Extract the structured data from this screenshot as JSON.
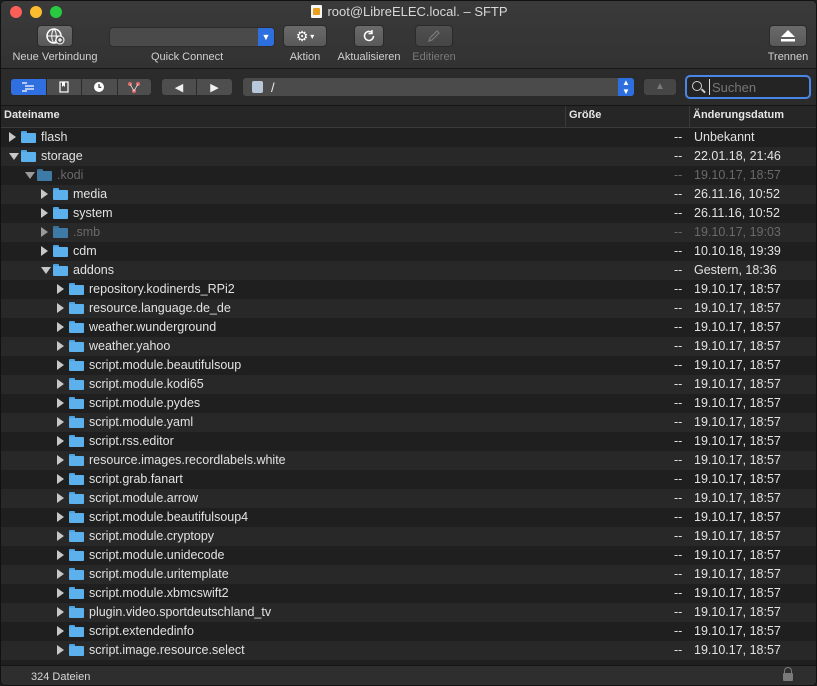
{
  "window": {
    "title": "root@LibreELEC.local. – SFTP"
  },
  "toolbar": {
    "new_connection": "Neue Verbindung",
    "quick_connect": "Quick Connect",
    "quick_connect_value": "",
    "action": "Aktion",
    "refresh": "Aktualisieren",
    "edit": "Editieren",
    "disconnect": "Trennen"
  },
  "pathbar": {
    "path": "/",
    "search_placeholder": "Suchen"
  },
  "columns": {
    "name": "Dateiname",
    "size": "Größe",
    "date": "Änderungsdatum"
  },
  "rows": [
    {
      "name": "flash",
      "size": "--",
      "date": "Unbekannt",
      "depth": 0,
      "expanded": false,
      "dim": false
    },
    {
      "name": "storage",
      "size": "--",
      "date": "22.01.18, 21:46",
      "depth": 0,
      "expanded": true,
      "dim": false
    },
    {
      "name": ".kodi",
      "size": "--",
      "date": "19.10.17, 18:57",
      "depth": 1,
      "expanded": true,
      "dim": true
    },
    {
      "name": "media",
      "size": "--",
      "date": "26.11.16, 10:52",
      "depth": 2,
      "expanded": false,
      "dim": false
    },
    {
      "name": "system",
      "size": "--",
      "date": "26.11.16, 10:52",
      "depth": 2,
      "expanded": false,
      "dim": false
    },
    {
      "name": ".smb",
      "size": "--",
      "date": "19.10.17, 19:03",
      "depth": 2,
      "expanded": false,
      "dim": true
    },
    {
      "name": "cdm",
      "size": "--",
      "date": "10.10.18, 19:39",
      "depth": 2,
      "expanded": false,
      "dim": false
    },
    {
      "name": "addons",
      "size": "--",
      "date": "Gestern, 18:36",
      "depth": 2,
      "expanded": true,
      "dim": false
    },
    {
      "name": "repository.kodinerds_RPi2",
      "size": "--",
      "date": "19.10.17, 18:57",
      "depth": 3,
      "expanded": false,
      "dim": false
    },
    {
      "name": "resource.language.de_de",
      "size": "--",
      "date": "19.10.17, 18:57",
      "depth": 3,
      "expanded": false,
      "dim": false
    },
    {
      "name": "weather.wunderground",
      "size": "--",
      "date": "19.10.17, 18:57",
      "depth": 3,
      "expanded": false,
      "dim": false
    },
    {
      "name": "weather.yahoo",
      "size": "--",
      "date": "19.10.17, 18:57",
      "depth": 3,
      "expanded": false,
      "dim": false
    },
    {
      "name": "script.module.beautifulsoup",
      "size": "--",
      "date": "19.10.17, 18:57",
      "depth": 3,
      "expanded": false,
      "dim": false
    },
    {
      "name": "script.module.kodi65",
      "size": "--",
      "date": "19.10.17, 18:57",
      "depth": 3,
      "expanded": false,
      "dim": false
    },
    {
      "name": "script.module.pydes",
      "size": "--",
      "date": "19.10.17, 18:57",
      "depth": 3,
      "expanded": false,
      "dim": false
    },
    {
      "name": "script.module.yaml",
      "size": "--",
      "date": "19.10.17, 18:57",
      "depth": 3,
      "expanded": false,
      "dim": false
    },
    {
      "name": "script.rss.editor",
      "size": "--",
      "date": "19.10.17, 18:57",
      "depth": 3,
      "expanded": false,
      "dim": false
    },
    {
      "name": "resource.images.recordlabels.white",
      "size": "--",
      "date": "19.10.17, 18:57",
      "depth": 3,
      "expanded": false,
      "dim": false
    },
    {
      "name": "script.grab.fanart",
      "size": "--",
      "date": "19.10.17, 18:57",
      "depth": 3,
      "expanded": false,
      "dim": false
    },
    {
      "name": "script.module.arrow",
      "size": "--",
      "date": "19.10.17, 18:57",
      "depth": 3,
      "expanded": false,
      "dim": false
    },
    {
      "name": "script.module.beautifulsoup4",
      "size": "--",
      "date": "19.10.17, 18:57",
      "depth": 3,
      "expanded": false,
      "dim": false
    },
    {
      "name": "script.module.cryptopy",
      "size": "--",
      "date": "19.10.17, 18:57",
      "depth": 3,
      "expanded": false,
      "dim": false
    },
    {
      "name": "script.module.unidecode",
      "size": "--",
      "date": "19.10.17, 18:57",
      "depth": 3,
      "expanded": false,
      "dim": false
    },
    {
      "name": "script.module.uritemplate",
      "size": "--",
      "date": "19.10.17, 18:57",
      "depth": 3,
      "expanded": false,
      "dim": false
    },
    {
      "name": "script.module.xbmcswift2",
      "size": "--",
      "date": "19.10.17, 18:57",
      "depth": 3,
      "expanded": false,
      "dim": false
    },
    {
      "name": "plugin.video.sportdeutschland_tv",
      "size": "--",
      "date": "19.10.17, 18:57",
      "depth": 3,
      "expanded": false,
      "dim": false
    },
    {
      "name": "script.extendedinfo",
      "size": "--",
      "date": "19.10.17, 18:57",
      "depth": 3,
      "expanded": false,
      "dim": false
    },
    {
      "name": "script.image.resource.select",
      "size": "--",
      "date": "19.10.17, 18:57",
      "depth": 3,
      "expanded": false,
      "dim": false
    }
  ],
  "status": {
    "count": "324 Dateien"
  },
  "colors": {
    "accent": "#2f6fe0",
    "folder": "#5cb1ec",
    "search_focus": "#4a86e8"
  },
  "icons": {
    "new_connection": "globe-plus-icon",
    "action": "gear-icon",
    "refresh": "refresh-icon",
    "edit": "pencil-icon",
    "disconnect": "eject-icon",
    "search": "search-icon",
    "lock": "lock-icon"
  }
}
